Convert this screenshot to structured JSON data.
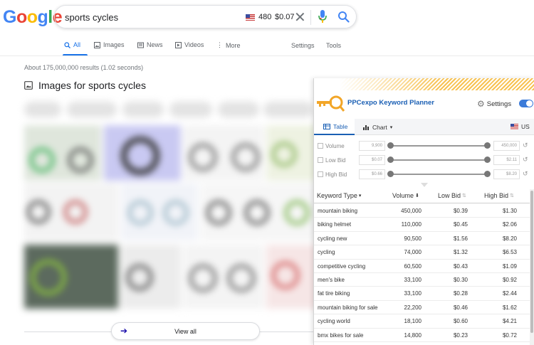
{
  "google": {
    "logo": "Google",
    "query": "sports cycles",
    "search_volume": "480",
    "search_cpc": "$0.07",
    "tabs": [
      {
        "label": "All",
        "icon": "search-icon"
      },
      {
        "label": "Images",
        "icon": "image-icon"
      },
      {
        "label": "News",
        "icon": "news-icon"
      },
      {
        "label": "Videos",
        "icon": "video-icon"
      },
      {
        "label": "More",
        "icon": "more-vert-icon"
      }
    ],
    "settings_label": "Settings",
    "tools_label": "Tools",
    "result_stats": "About 175,000,000 results (1.02 seconds)",
    "images_heading": "Images for sports cycles",
    "view_all_label": "View all"
  },
  "ppcexpo": {
    "title": "PPCexpo Keyword Planner",
    "settings_label": "Settings",
    "toggle_on": true,
    "accent_color": "#1a5fb4",
    "tabs": [
      {
        "label": "Table",
        "icon": "table-icon",
        "active": true
      },
      {
        "label": "Chart",
        "icon": "chart-icon",
        "active": false
      }
    ],
    "country": "US",
    "filters": [
      {
        "label": "Volume",
        "min": "9,900",
        "max": "450,000"
      },
      {
        "label": "Low Bid",
        "min": "$0.07",
        "max": "$2.11"
      },
      {
        "label": "High Bid",
        "min": "$0.66",
        "max": "$8.20"
      }
    ],
    "columns": {
      "keyword": "Keyword Type",
      "volume": "Volume",
      "low_bid": "Low Bid",
      "high_bid": "High Bid"
    },
    "rows": [
      {
        "keyword": "mountain biking",
        "volume": "450,000",
        "low": "$0.39",
        "high": "$1.30"
      },
      {
        "keyword": "biking helmet",
        "volume": "110,000",
        "low": "$0.45",
        "high": "$2.06"
      },
      {
        "keyword": "cycling new",
        "volume": "90,500",
        "low": "$1.56",
        "high": "$8.20"
      },
      {
        "keyword": "cycling",
        "volume": "74,000",
        "low": "$1.32",
        "high": "$6.53"
      },
      {
        "keyword": "competitive cycling",
        "volume": "60,500",
        "low": "$0.43",
        "high": "$1.09"
      },
      {
        "keyword": "men's bike",
        "volume": "33,100",
        "low": "$0.30",
        "high": "$0.92"
      },
      {
        "keyword": "fat tire biking",
        "volume": "33,100",
        "low": "$0.28",
        "high": "$2.44"
      },
      {
        "keyword": "mountain biking for sale",
        "volume": "22,200",
        "low": "$0.46",
        "high": "$1.62"
      },
      {
        "keyword": "cycling world",
        "volume": "18,100",
        "low": "$0.60",
        "high": "$4.21"
      },
      {
        "keyword": "bmx bikes for sale",
        "volume": "14,800",
        "low": "$0.23",
        "high": "$0.72"
      }
    ]
  }
}
